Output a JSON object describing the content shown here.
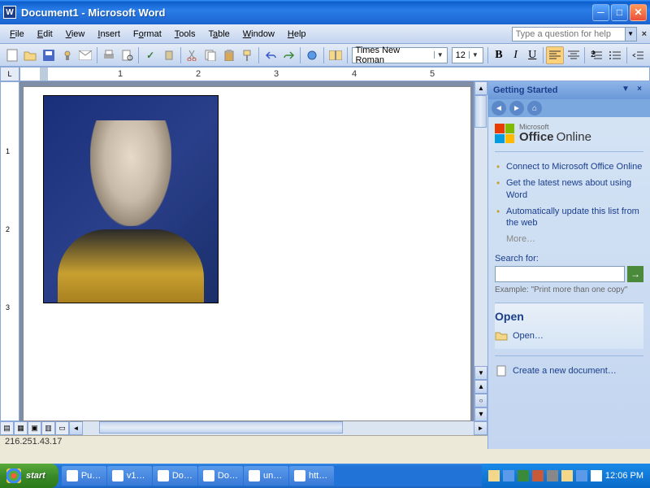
{
  "titlebar": {
    "title": "Document1 - Microsoft Word"
  },
  "menubar": {
    "items": [
      "File",
      "Edit",
      "View",
      "Insert",
      "Format",
      "Tools",
      "Table",
      "Window",
      "Help"
    ],
    "help_placeholder": "Type a question for help"
  },
  "toolbar": {
    "font_name": "Times New Roman",
    "font_size": "12"
  },
  "ruler": {
    "marks": [
      "1",
      "2",
      "3",
      "4",
      "5"
    ]
  },
  "vruler": {
    "marks": [
      "1",
      "2",
      "3"
    ]
  },
  "taskpane": {
    "title": "Getting Started",
    "brand_small": "Microsoft",
    "brand_big": "Office",
    "brand_suffix": "Online",
    "links": [
      "Connect to Microsoft Office Online",
      "Get the latest news about using Word",
      "Automatically update this list from the web"
    ],
    "more": "More…",
    "search_label": "Search for:",
    "example": "Example: \"Print more than one copy\"",
    "open_section": "Open",
    "open_action": "Open…",
    "new_action": "Create a new document…"
  },
  "status": {
    "text": "216.251.43.17"
  },
  "taskbar": {
    "start": "start",
    "items": [
      "Pu…",
      "v1…",
      "Do…",
      "Do…",
      "un…",
      "htt…"
    ],
    "clock": "12:06 PM"
  }
}
